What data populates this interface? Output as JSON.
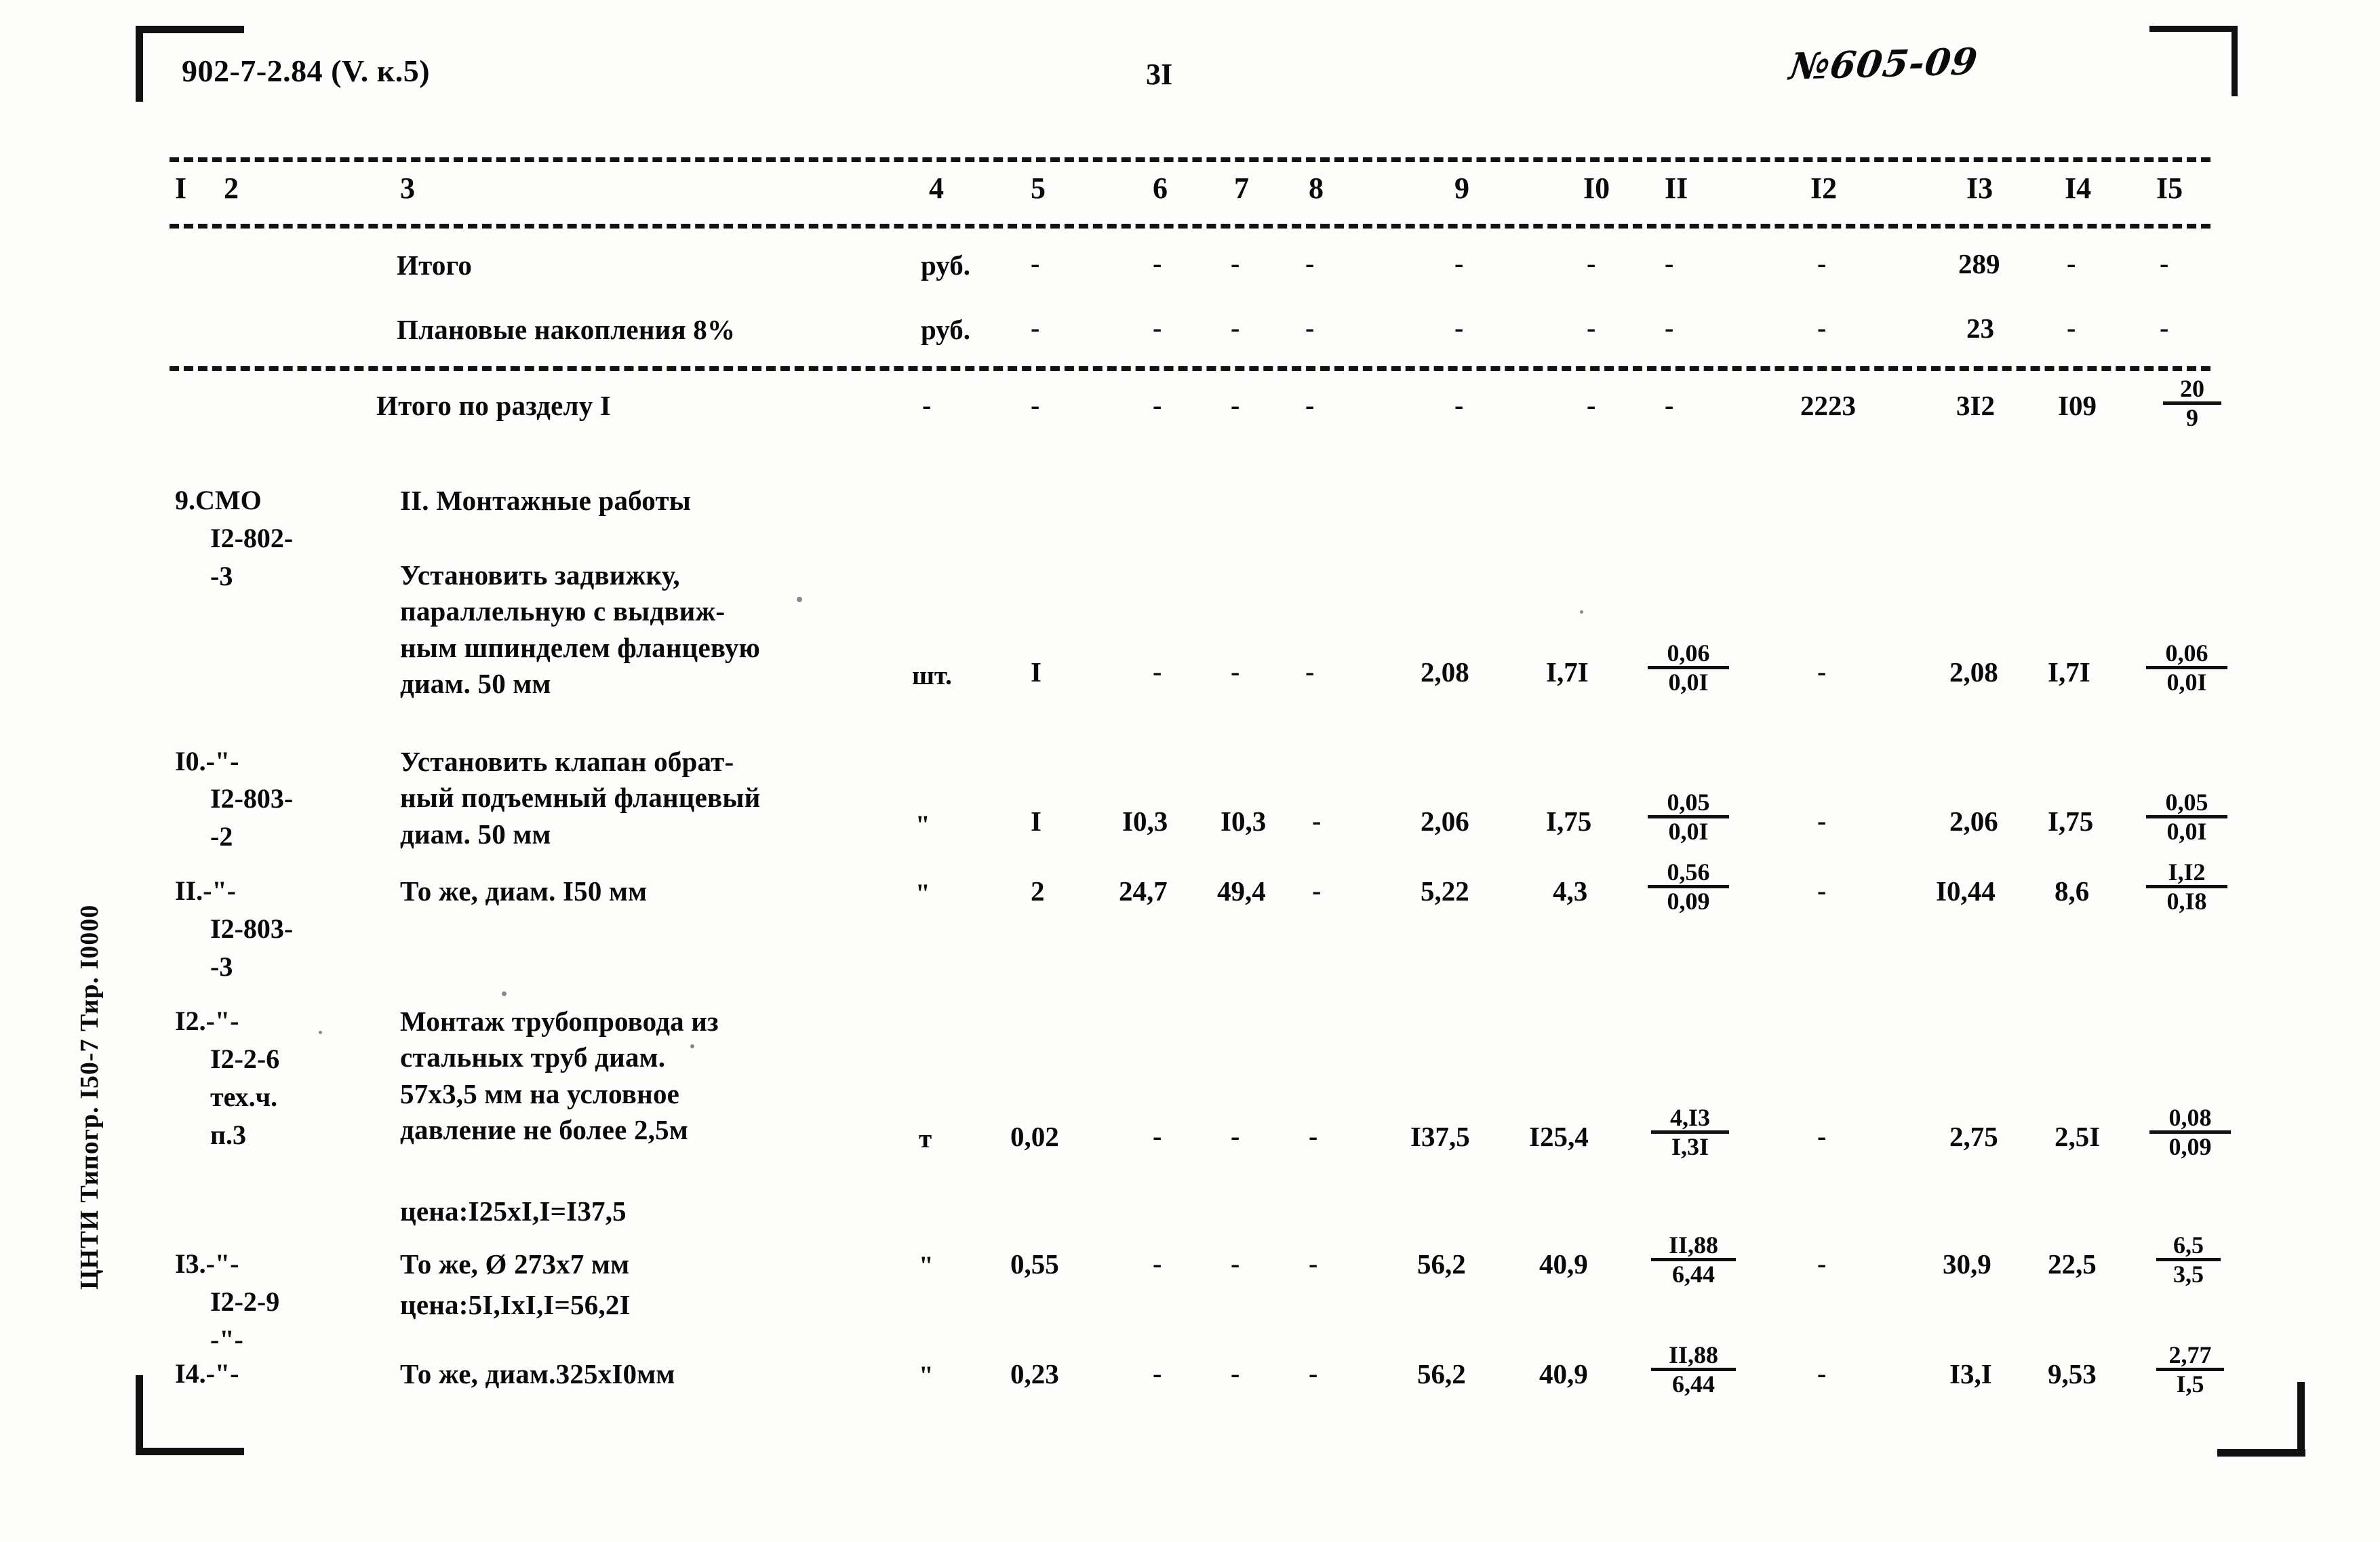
{
  "header": {
    "doc_code": "902-7-2.84 (V. к.5)",
    "page_number": "3I",
    "stamp_code": "№605-09"
  },
  "side_imprint": "ЦНТИ Типогр. I50-7 Тир. I0000",
  "table": {
    "column_headers": [
      "I",
      "2",
      "3",
      "4",
      "5",
      "6",
      "7",
      "8",
      "9",
      "I0",
      "II",
      "I2",
      "I3",
      "I4",
      "I5"
    ],
    "summary_rows": [
      {
        "name": "Итого",
        "label": "Итого",
        "unit": "руб.",
        "c5": "-",
        "c6": "-",
        "c7": "-",
        "c8": "-",
        "c9": "-",
        "c10": "-",
        "c11": "-",
        "c12": "-",
        "c13": "289",
        "c14": "-",
        "c15": "-"
      },
      {
        "name": "Плановые накопления 8%",
        "label": "Плановые накопления 8%",
        "unit": "руб.",
        "c5": "-",
        "c6": "-",
        "c7": "-",
        "c8": "-",
        "c9": "-",
        "c10": "-",
        "c11": "-",
        "c12": "-",
        "c13": "23",
        "c14": "-",
        "c15": "-"
      }
    ],
    "section_total": {
      "label": "Итого по разделу I",
      "c4": "-",
      "c5": "-",
      "c6": "-",
      "c7": "-",
      "c8": "-",
      "c9": "-",
      "c10": "-",
      "c11": "-",
      "c12": "2223",
      "c13": "3I2",
      "c14": "I09",
      "c15_num": "20",
      "c15_den": "9"
    },
    "section_title": "II. Монтажные работы",
    "rows": [
      {
        "no": "9.СМО",
        "code_line2": "I2-802-",
        "code_line3": "-3",
        "desc": "Установить задвижку,\nпараллельную с выдвиж-\nным шпинделем фланцевую\nдиам. 50 мм",
        "unit": "шт.",
        "c5": "I",
        "c6": "-",
        "c7": "-",
        "c8": "-",
        "c9": "2,08",
        "c10": "I,7I",
        "c11_num": "0,06",
        "c11_den": "0,0I",
        "c12": "-",
        "c13": "2,08",
        "c14": "I,7I",
        "c15_num": "0,06",
        "c15_den": "0,0I"
      },
      {
        "no": "I0.-\"-",
        "code_line2": "I2-803-",
        "code_line3": "-2",
        "desc": "Установить клапан обрат-\nный подъемный фланцевый\nдиам. 50 мм",
        "unit": "\"",
        "c5": "I",
        "c6": "I0,3",
        "c7": "I0,3",
        "c8": "-",
        "c9": "2,06",
        "c10": "I,75",
        "c11_num": "0,05",
        "c11_den": "0,0I",
        "c12": "-",
        "c13": "2,06",
        "c14": "I,75",
        "c15_num": "0,05",
        "c15_den": "0,0I"
      },
      {
        "no": "II.-\"-",
        "code_line2": "I2-803-",
        "code_line3": "-3",
        "desc": "То же, диам. I50 мм",
        "unit": "\"",
        "c5": "2",
        "c6": "24,7",
        "c7": "49,4",
        "c8": "-",
        "c9": "5,22",
        "c10": "4,3",
        "c11_num": "0,56",
        "c11_den": "0,09",
        "c12": "-",
        "c13": "I0,44",
        "c14": "8,6",
        "c15_num": "I,I2",
        "c15_den": "0,I8"
      },
      {
        "no": "I2.-\"-",
        "code_line2": "I2-2-6",
        "code_line3": "тех.ч.",
        "code_line4": "п.3",
        "desc": "Монтаж трубопровода из\nстальных труб диам.\n57х3,5 мм на условное\nдавление не более 2,5м",
        "note": "цена:I25хI,I=I37,5",
        "unit": "т",
        "c5": "0,02",
        "c6": "-",
        "c7": "-",
        "c8": "-",
        "c9": "I37,5",
        "c10": "I25,4",
        "c11_num": "4,I3",
        "c11_den": "I,3I",
        "c12": "-",
        "c13": "2,75",
        "c14": "2,5I",
        "c15_num": "0,08",
        "c15_den": "0,09"
      },
      {
        "no": "I3.-\"-",
        "code_line2": "I2-2-9",
        "code_line3": "-\"-",
        "desc": "То же, Ø 273х7 мм",
        "note": "цена:5I,IхI,I=56,2I",
        "unit": "\"",
        "c5": "0,55",
        "c6": "-",
        "c7": "-",
        "c8": "-",
        "c9": "56,2",
        "c10": "40,9",
        "c11_num": "II,88",
        "c11_den": "6,44",
        "c12": "-",
        "c13": "30,9",
        "c14": "22,5",
        "c15_num": "6,5",
        "c15_den": "3,5"
      },
      {
        "no": "I4.-\"-",
        "desc": "То же, диам.325хI0мм",
        "unit": "\"",
        "c5": "0,23",
        "c6": "-",
        "c7": "-",
        "c8": "-",
        "c9": "56,2",
        "c10": "40,9",
        "c11_num": "II,88",
        "c11_den": "6,44",
        "c12": "-",
        "c13": "I3,I",
        "c14": "9,53",
        "c15_num": "2,77",
        "c15_den": "I,5"
      }
    ]
  }
}
